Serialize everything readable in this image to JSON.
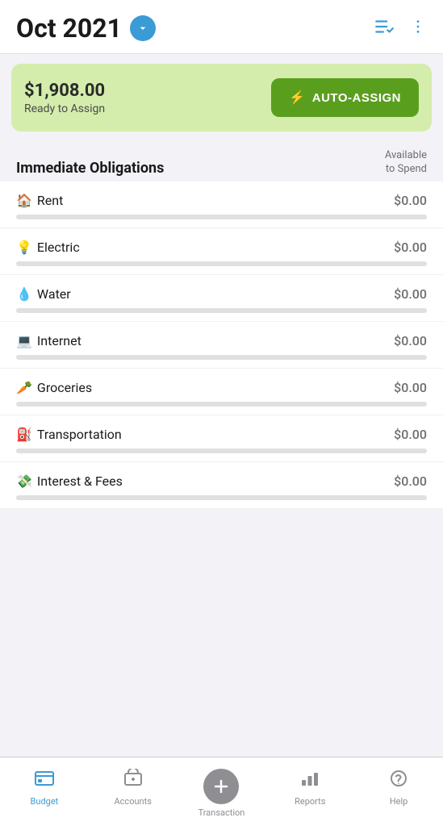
{
  "header": {
    "title": "Oct 2021",
    "dropdown_icon": "chevron-down",
    "edit_icon": "edit-list",
    "more_icon": "more-vertical"
  },
  "banner": {
    "amount": "$1,908.00",
    "label": "Ready to Assign",
    "button_label": "AUTO-ASSIGN"
  },
  "section": {
    "title": "Immediate Obligations",
    "column_label_line1": "Available",
    "column_label_line2": "to Spend"
  },
  "budget_items": [
    {
      "emoji": "🏠",
      "name": "Rent",
      "amount": "$0.00"
    },
    {
      "emoji": "💡",
      "name": "Electric",
      "amount": "$0.00"
    },
    {
      "emoji": "💧",
      "name": "Water",
      "amount": "$0.00"
    },
    {
      "emoji": "💻",
      "name": "Internet",
      "amount": "$0.00"
    },
    {
      "emoji": "🥕",
      "name": "Groceries",
      "amount": "$0.00"
    },
    {
      "emoji": "⛽",
      "name": "Transportation",
      "amount": "$0.00"
    },
    {
      "emoji": "💸",
      "name": "Interest & Fees",
      "amount": "$0.00"
    }
  ],
  "nav": {
    "items": [
      {
        "id": "budget",
        "label": "Budget",
        "icon": "budget-icon",
        "active": true
      },
      {
        "id": "accounts",
        "label": "Accounts",
        "icon": "accounts-icon",
        "active": false
      },
      {
        "id": "transaction",
        "label": "Transaction",
        "icon": "add-icon",
        "active": false
      },
      {
        "id": "reports",
        "label": "Reports",
        "icon": "reports-icon",
        "active": false
      },
      {
        "id": "help",
        "label": "Help",
        "icon": "help-icon",
        "active": false
      }
    ]
  }
}
